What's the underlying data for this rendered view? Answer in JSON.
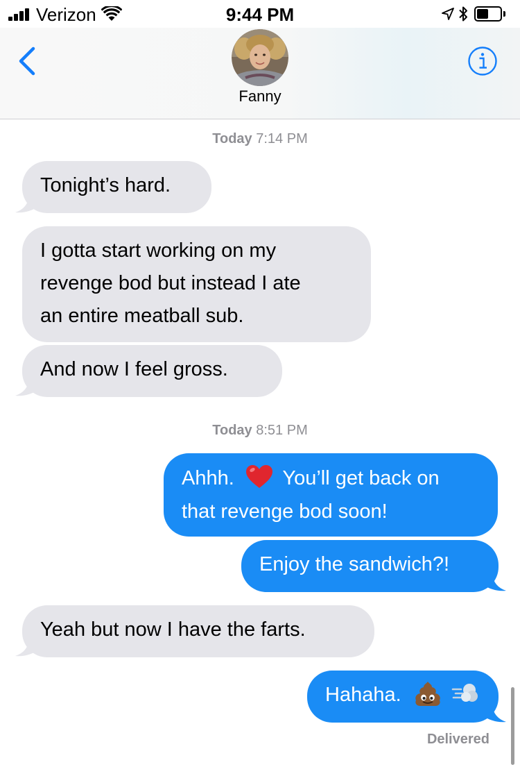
{
  "status_bar": {
    "carrier": "Verizon",
    "time": "9:44 PM"
  },
  "header": {
    "contact_name": "Fanny",
    "icons": [
      "back-chevron-icon",
      "info-icon"
    ]
  },
  "messages": [
    {
      "type": "timestamp",
      "day": "Today",
      "time": "7:14 PM"
    },
    {
      "type": "received",
      "text": "Tonight’s hard."
    },
    {
      "type": "received",
      "lines": [
        "I gotta start working on my",
        "revenge bod but instead I ate",
        "an entire meatball sub."
      ]
    },
    {
      "type": "received",
      "text": "And now I feel gross."
    },
    {
      "type": "timestamp",
      "day": "Today",
      "time": "8:51 PM"
    },
    {
      "type": "sent",
      "line1_before": "Ahhh.",
      "line1_after": "You’ll get back on",
      "line2": "that revenge bod soon!",
      "emoji": [
        "red-heart"
      ]
    },
    {
      "type": "sent",
      "text": "Enjoy the sandwich?!"
    },
    {
      "type": "received",
      "text": "Yeah but now I have the farts."
    },
    {
      "type": "sent",
      "text": "Hahaha.",
      "emoji": [
        "pile-of-poo",
        "dashing-away"
      ]
    }
  ],
  "delivery_status": "Delivered",
  "colors": {
    "sent_bubble": "#1a8cf5",
    "received_bubble": "#e5e5ea",
    "ios_blue": "#147efb",
    "timestamp_gray": "#8e8e93"
  }
}
